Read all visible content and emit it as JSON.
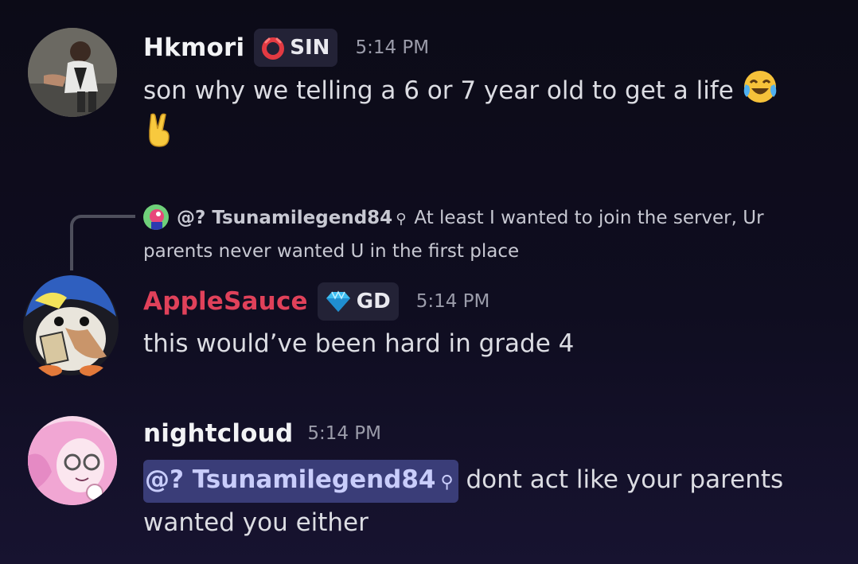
{
  "messages": [
    {
      "author": "Hkmori",
      "author_color": "#f2f3f5",
      "tag": "SIN",
      "tag_icon": "red-ring-icon",
      "time": "5:14 PM",
      "line1": "son why we telling a 6 or 7 year old to get a life",
      "emoji_1": "joy-emoji-icon",
      "emoji_2": "victory-hand-emoji-icon"
    },
    {
      "reply": {
        "mention": "@? Tsunamilegend84",
        "text": "At least I wanted to join the server, Ur parents never wanted U in the first place"
      },
      "author": "AppleSauce",
      "author_color": "#e0415a",
      "tag": "GD",
      "tag_icon": "diamond-icon",
      "time": "5:14 PM",
      "line1": "this would’ve been hard in grade 4"
    },
    {
      "author": "nightcloud",
      "author_color": "#f2f3f5",
      "time": "5:14 PM",
      "mention": "@? Tsunamilegend84",
      "line1_rest": "dont act like your parents",
      "line2": "wanted you either"
    }
  ]
}
